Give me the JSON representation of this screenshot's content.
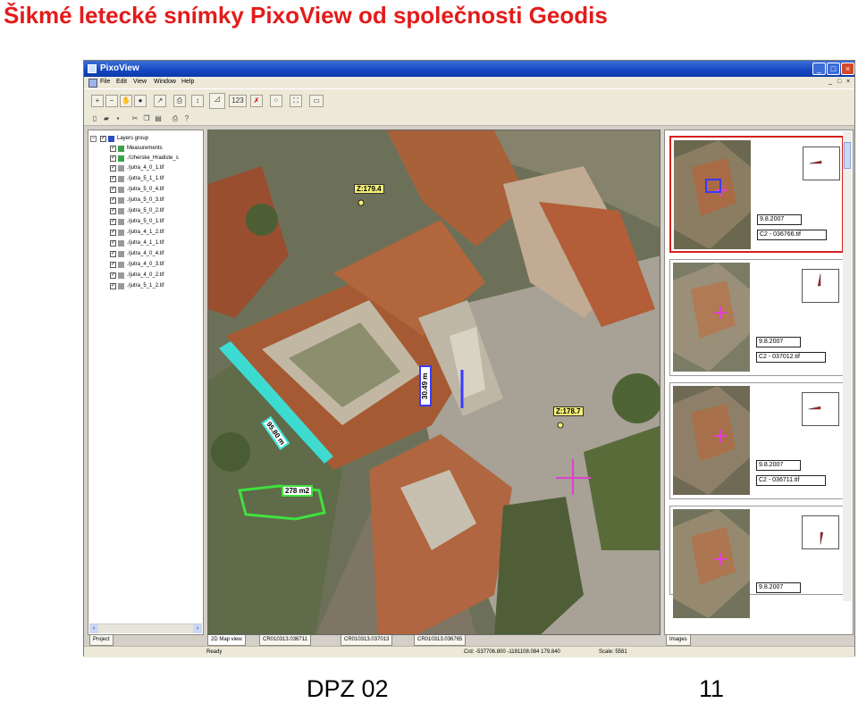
{
  "slide": {
    "title": "Šikmé letecké snímky PixoView od společnosti Geodis",
    "footer_left": "DPZ 02",
    "page_number": "11"
  },
  "window": {
    "title": "PixoView",
    "menu": [
      "File",
      "Edit",
      "View",
      "Window",
      "Help"
    ],
    "controls": {
      "minimize": "_",
      "maximize": "□",
      "close": "×"
    },
    "toolbar_text": "123"
  },
  "layers": {
    "group": "Layers group",
    "measurements": "Measurements",
    "project_name": "./Uherske_Hradiste_s",
    "files": [
      "./jutra_4_0_1.tif",
      "./jutra_5_1_1.tif",
      "./jutra_5_0_4.tif",
      "./jutra_5_0_3.tif",
      "./jutra_5_0_2.tif",
      "./jutra_5_0_1.tif",
      "./jutra_4_1_2.tif",
      "./jutra_4_1_1.tif",
      "./jutra_4_0_4.tif",
      "./jutra_4_0_3.tif",
      "./jutra_4_0_2.tif",
      "./jutra_5_1_2.tif"
    ],
    "tab": "Project"
  },
  "map": {
    "labels": {
      "z1": "Z:179.4",
      "z2": "Z:178.7",
      "height": "30.49 m",
      "length": "95.80 m",
      "area": "278 m2"
    },
    "tabs": [
      "2D Map view",
      "CR010313.036711",
      "CR010313.037013",
      "CR010313.036765"
    ]
  },
  "images": {
    "tab": "Images",
    "items": [
      {
        "date": "9.8.2007",
        "name": "C2 - 036766.tif",
        "selected": true
      },
      {
        "date": "9.8.2007",
        "name": "C2 - 037012.tif",
        "selected": false
      },
      {
        "date": "9.8.2007",
        "name": "C2 - 036711.tif",
        "selected": false
      },
      {
        "date": "9.8.2007",
        "name": "",
        "selected": false
      }
    ]
  },
  "status": {
    "ready": "Ready",
    "coords": "Crd: -537706.800  -1181108.084  179.840",
    "scale": "Scale: 5581"
  },
  "colors": {
    "title_red": "#e31b1b",
    "titlebar_blue": "#1346c1",
    "label_yellow": "#f4ef78",
    "measure_green": "#3fe23f",
    "measure_cyan": "#37e8e0",
    "measure_blue": "#3a3aff",
    "cross_magenta": "#e040d0"
  }
}
